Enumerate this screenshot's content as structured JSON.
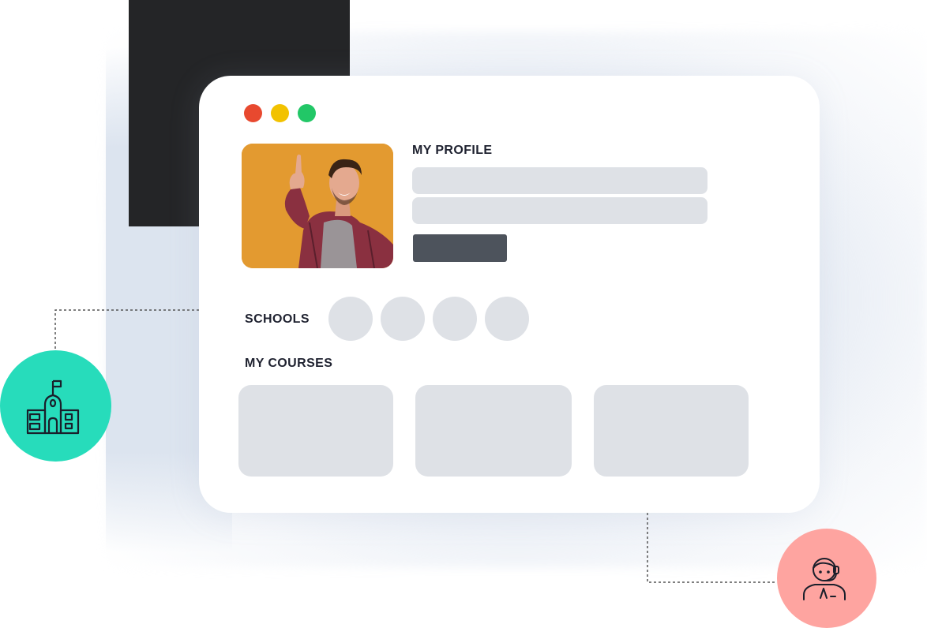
{
  "window": {
    "controls": [
      "close",
      "minimize",
      "maximize"
    ]
  },
  "profile": {
    "heading": "MY PROFILE",
    "photo_alt": "profile-photo"
  },
  "schools": {
    "heading": "SCHOOLS",
    "count": 4
  },
  "courses": {
    "heading": "MY COURSES",
    "count": 3
  },
  "icons": {
    "school": "school-building-icon",
    "support": "support-agent-icon"
  },
  "colors": {
    "dark_block": "#242527",
    "close": "#e8492f",
    "minimize": "#f2c200",
    "maximize": "#22c767",
    "placeholder": "#dee1e6",
    "button": "#4d535c",
    "school_badge": "#27dcbb",
    "support_badge": "#fea4a0",
    "photo_bg": "#e39a30"
  }
}
